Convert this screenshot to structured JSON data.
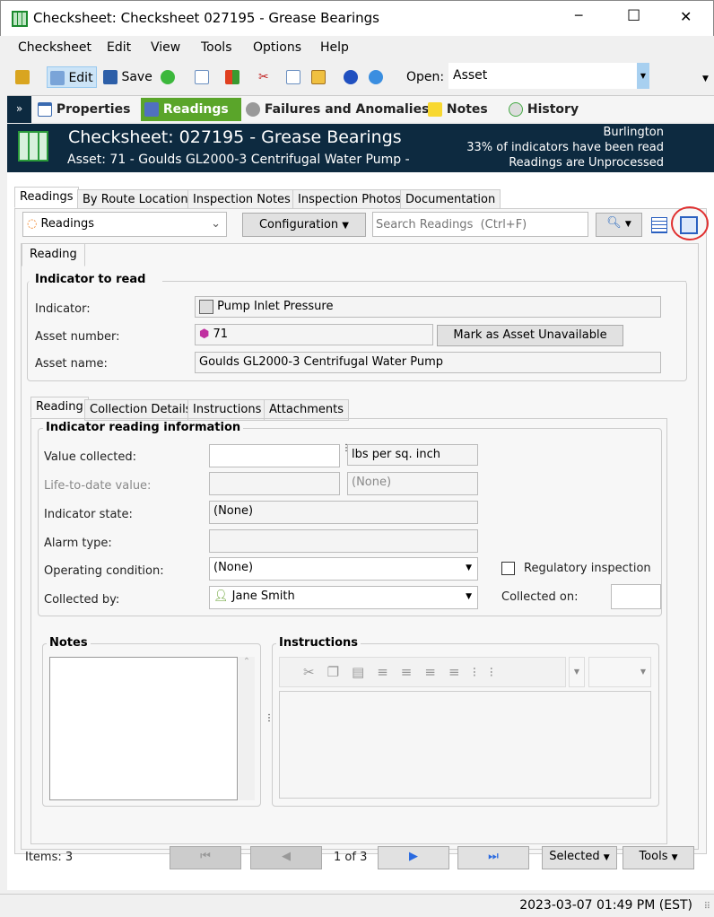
{
  "window": {
    "title": "Checksheet: Checksheet  027195 - Grease Bearings",
    "minimize": "─",
    "maximize": "☐",
    "close": "✕"
  },
  "menu": [
    "Checksheet",
    "Edit",
    "View",
    "Tools",
    "Options",
    "Help"
  ],
  "toolbar": {
    "edit": "Edit",
    "save": "Save",
    "open_label": "Open:",
    "open_value": "Asset"
  },
  "nav": {
    "items": [
      "Properties",
      "Readings",
      "Failures and Anomalies",
      "Notes",
      "History"
    ]
  },
  "header": {
    "title": "Checksheet: 027195 - Grease Bearings",
    "subtitle": "Asset: 71 - Goulds  GL2000-3 Centrifugal Water Pump -",
    "location": "Burlington",
    "progress_text": "33% of indicators  have been read",
    "status": "Readings are Unprocessed",
    "progress_percent": 33
  },
  "tabs": [
    "Readings",
    "By Route Location",
    "Inspection Notes",
    "Inspection Photos",
    "Documentation"
  ],
  "readings_bar": {
    "view_select": "Readings",
    "configuration": "Configuration",
    "search_placeholder": "Search Readings  (Ctrl+F)"
  },
  "inner_tab": "Reading",
  "indicator_group": {
    "title": "Indicator to read",
    "indicator_label": "Indicator:",
    "indicator_value": "Pump Inlet Pressure",
    "asset_number_label": "Asset number:",
    "asset_number_value": "71",
    "mark_unavailable": "Mark as Asset Unavailable",
    "asset_name_label": "Asset name:",
    "asset_name_value": "Goulds GL2000-3 Centrifugal Water Pump"
  },
  "sub_tabs": [
    "Reading",
    "Collection Details",
    "Instructions",
    "Attachments"
  ],
  "reading_info": {
    "title": "Indicator reading information",
    "value_collected_label": "Value collected:",
    "value_collected": "",
    "unit": "lbs per sq. inch",
    "ltd_label": "Life-to-date value:",
    "ltd_value": "",
    "ltd_unit": "(None)",
    "state_label": "Indicator state:",
    "state_value": "(None)",
    "alarm_label": "Alarm type:",
    "alarm_value": "",
    "opcond_label": "Operating condition:",
    "opcond_value": "(None)",
    "collected_by_label": "Collected by:",
    "collected_by_value": "Jane Smith",
    "regulatory_label": "Regulatory inspection",
    "collected_on_label": "Collected on:"
  },
  "notes": {
    "title": "Notes"
  },
  "instructions": {
    "title": "Instructions"
  },
  "footer": {
    "items": "Items: 3",
    "page": "1 of 3",
    "selected": "Selected",
    "tools": "Tools"
  },
  "statusbar": {
    "datetime": "2023-03-07 01:49 PM (EST)"
  }
}
